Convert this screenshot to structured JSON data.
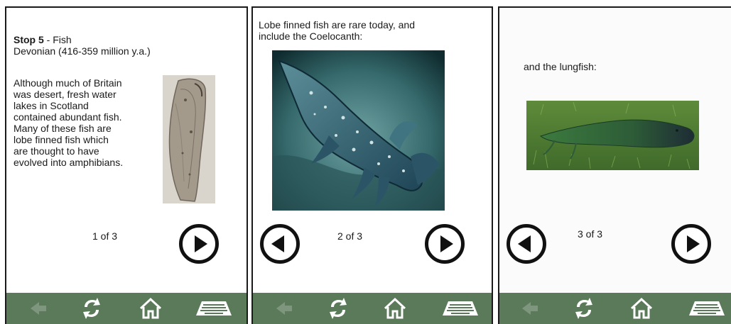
{
  "screens": [
    {
      "title_bold": "Stop 5",
      "title_rest": " - Fish",
      "subtitle": "Devonian (416-359 million y.a.)",
      "body": "Although much of Britain\nwas desert, fresh water\nlakes in Scotland\ncontained abundant fish.\nMany of these fish are\nlobe finned fish which\nare thought to have\nevolved into amphibians.",
      "counter": "1 of 3"
    },
    {
      "body": "Lobe finned fish are rare today, and\ninclude the Coelocanth:",
      "counter": "2 of 3"
    },
    {
      "body": "and the lungfish:",
      "counter": "3 of 3"
    }
  ],
  "icons": {
    "back": "back-arrow-icon",
    "refresh": "refresh-icon",
    "home": "home-icon",
    "keyboard": "keyboard-icon",
    "previous": "previous-circle-icon",
    "next": "next-circle-icon"
  },
  "colors": {
    "toolbar": "#5a7a5a",
    "toolbar_icon": "#ffffff",
    "toolbar_icon_disabled": "#7e967e"
  }
}
